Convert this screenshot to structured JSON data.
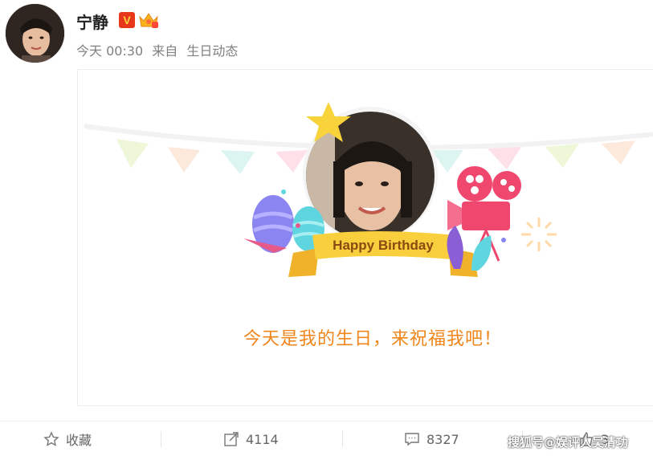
{
  "post": {
    "author": {
      "name": "宁静",
      "verified_icon": "v-badge-icon",
      "crown_icon": "crown-icon"
    },
    "meta": {
      "time": "今天 00:30",
      "source_prefix": "来自",
      "source": "生日动态"
    },
    "card": {
      "banner_text": "Happy Birthday",
      "message": "今天是我的生日，来祝福我吧！"
    }
  },
  "actions": {
    "favorite": {
      "icon": "star-icon",
      "label": "收藏"
    },
    "repost": {
      "icon": "share-icon",
      "count": "4114"
    },
    "comment": {
      "icon": "comment-icon",
      "count": "8327"
    },
    "like": {
      "icon": "like-icon",
      "count": "3"
    }
  },
  "watermark": "搜狐号@娱评人吴清功",
  "colors": {
    "accent": "#f08519",
    "verified": "#e8361b"
  }
}
